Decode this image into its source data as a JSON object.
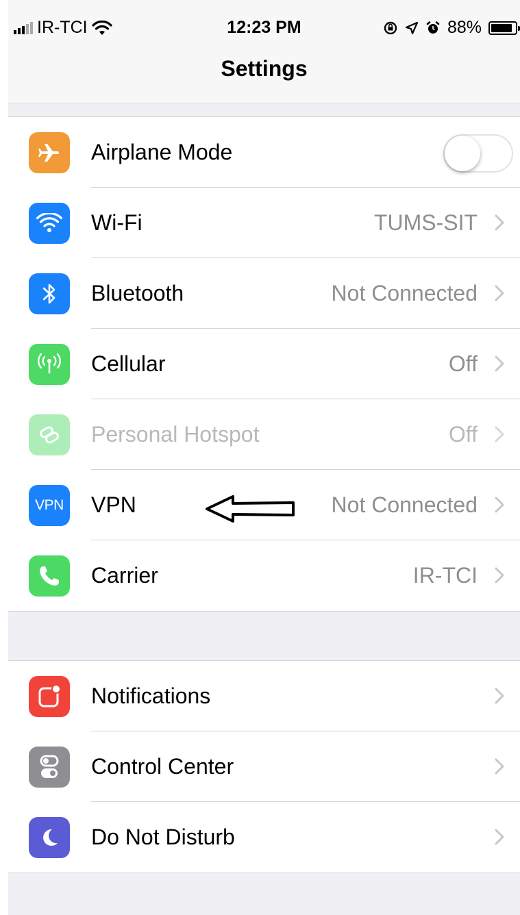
{
  "status_bar": {
    "carrier": "IR-TCI",
    "time": "12:23 PM",
    "battery": "88%",
    "battery_level": 0.88
  },
  "nav": {
    "title": "Settings"
  },
  "groups": [
    {
      "rows": [
        {
          "label": "Airplane Mode",
          "icon": "airplane-icon",
          "color": "#f19a37",
          "toggle": false
        },
        {
          "label": "Wi-Fi",
          "value": "TUMS-SIT",
          "icon": "wifi-icon",
          "color": "#1a82fb"
        },
        {
          "label": "Bluetooth",
          "value": "Not Connected",
          "icon": "bluetooth-icon",
          "color": "#1a82fb"
        },
        {
          "label": "Cellular",
          "value": "Off",
          "icon": "cellular-icon",
          "color": "#4cd964"
        },
        {
          "label": "Personal Hotspot",
          "value": "Off",
          "icon": "hotspot-icon",
          "color": "#4cd964",
          "disabled": true
        },
        {
          "label": "VPN",
          "value": "Not Connected",
          "icon": "vpn-icon",
          "icon_text": "VPN",
          "color": "#1a82fb"
        },
        {
          "label": "Carrier",
          "value": "IR-TCI",
          "icon": "phone-icon",
          "color": "#4cd964"
        }
      ]
    },
    {
      "rows": [
        {
          "label": "Notifications",
          "icon": "notifications-icon",
          "color": "#f2433a"
        },
        {
          "label": "Control Center",
          "icon": "control-center-icon",
          "color": "#8e8e93"
        },
        {
          "label": "Do Not Disturb",
          "icon": "moon-icon",
          "color": "#5b5bd6"
        }
      ]
    }
  ],
  "annotation": {
    "icon": "hand-drawn-arrow-icon",
    "points_to": "VPN"
  }
}
